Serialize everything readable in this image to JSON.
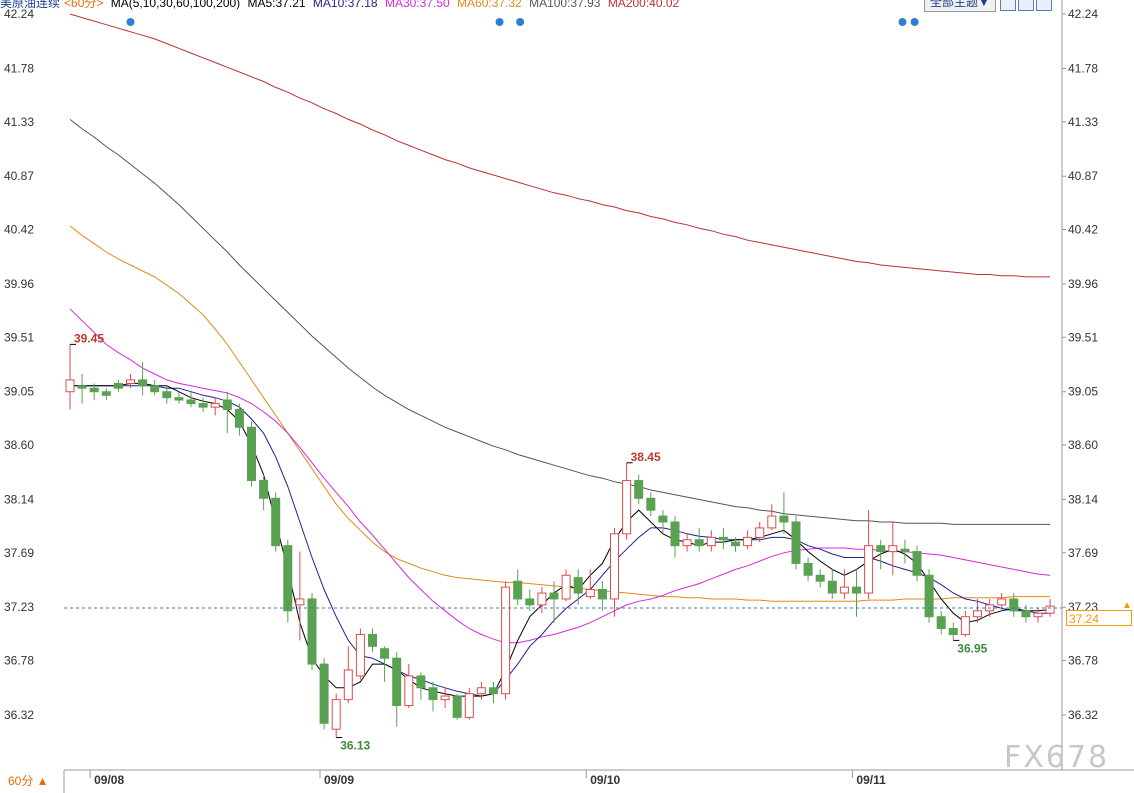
{
  "legend": {
    "symbol": "美原油连续",
    "period_tag": "<60分>",
    "ma_label": "MA(5,10,30,60,100,200)",
    "ma5": "MA5:37.21",
    "ma10": "MA10:37.18",
    "ma30": "MA30:37.50",
    "ma60": "MA60:37.32",
    "ma100": "MA100:37.93",
    "ma200": "MA200:40.02"
  },
  "toolbar": {
    "theme_label": "全部主题▼",
    "zoom_in_icon": "zoom-in-icon",
    "zoom_out_icon": "zoom-out-icon",
    "settings_icon": "settings-icon"
  },
  "period_button": "60分 ▲",
  "watermark": "FX678",
  "current_price": "37.24",
  "colors": {
    "up": "#e04b4b",
    "down": "#5aa152",
    "ma5": "#000000",
    "ma10": "#1f1f8f",
    "ma30": "#d52cd6",
    "ma60": "#e08a18",
    "ma100": "#555555",
    "ma200": "#b83232",
    "dots": "#2f7fd1",
    "last_price": "#2e7fb8"
  },
  "chart_data": {
    "type": "candlestick",
    "y_ticks": [
      "42.24",
      "41.78",
      "41.33",
      "40.87",
      "40.42",
      "39.96",
      "39.51",
      "39.05",
      "38.60",
      "38.14",
      "37.69",
      "37.23",
      "36.78",
      "36.32"
    ],
    "ylim": [
      35.99,
      42.38
    ],
    "x_ticks": [
      {
        "index": 1,
        "label": "09/08"
      },
      {
        "index": 20,
        "label": "09/09"
      },
      {
        "index": 42,
        "label": "09/10"
      },
      {
        "index": 64,
        "label": "09/11"
      }
    ],
    "grid": false,
    "legend": "top-left",
    "candles": [
      [
        39.05,
        39.15,
        39.45,
        38.9
      ],
      [
        39.1,
        39.08,
        39.2,
        38.95
      ],
      [
        39.08,
        39.05,
        39.12,
        38.98
      ],
      [
        39.05,
        39.02,
        39.08,
        38.98
      ],
      [
        39.12,
        39.08,
        39.15,
        39.05
      ],
      [
        39.12,
        39.15,
        39.2,
        39.08
      ],
      [
        39.15,
        39.1,
        39.3,
        39.02
      ],
      [
        39.1,
        39.05,
        39.15,
        39.02
      ],
      [
        39.05,
        39.0,
        39.1,
        38.95
      ],
      [
        39.0,
        38.98,
        39.05,
        38.95
      ],
      [
        38.98,
        38.95,
        39.05,
        38.92
      ],
      [
        38.95,
        38.92,
        39.0,
        38.88
      ],
      [
        38.92,
        38.95,
        39.0,
        38.85
      ],
      [
        38.98,
        38.9,
        39.05,
        38.7
      ],
      [
        38.9,
        38.75,
        38.95,
        38.68
      ],
      [
        38.75,
        38.3,
        38.8,
        38.25
      ],
      [
        38.3,
        38.15,
        38.35,
        38.05
      ],
      [
        38.15,
        37.75,
        38.2,
        37.7
      ],
      [
        37.75,
        37.2,
        37.8,
        37.1
      ],
      [
        37.25,
        37.3,
        37.7,
        36.95
      ],
      [
        37.3,
        36.75,
        37.35,
        36.7
      ],
      [
        36.75,
        36.25,
        36.8,
        36.2
      ],
      [
        36.2,
        36.45,
        36.5,
        36.13
      ],
      [
        36.45,
        36.7,
        36.9,
        36.42
      ],
      [
        36.65,
        37.0,
        37.05,
        36.62
      ],
      [
        37.0,
        36.9,
        37.05,
        36.85
      ],
      [
        36.88,
        36.8,
        36.9,
        36.6
      ],
      [
        36.8,
        36.4,
        36.85,
        36.22
      ],
      [
        36.4,
        36.65,
        36.75,
        36.38
      ],
      [
        36.65,
        36.55,
        36.68,
        36.45
      ],
      [
        36.55,
        36.45,
        36.6,
        36.35
      ],
      [
        36.45,
        36.48,
        36.55,
        36.38
      ],
      [
        36.48,
        36.3,
        36.5,
        36.28
      ],
      [
        36.3,
        36.5,
        36.55,
        36.28
      ],
      [
        36.5,
        36.55,
        36.6,
        36.45
      ],
      [
        36.55,
        36.5,
        36.6,
        36.42
      ],
      [
        36.5,
        37.4,
        37.45,
        36.45
      ],
      [
        37.45,
        37.3,
        37.55,
        37.25
      ],
      [
        37.3,
        37.25,
        37.38,
        37.2
      ],
      [
        37.25,
        37.35,
        37.4,
        37.18
      ],
      [
        37.35,
        37.3,
        37.45,
        37.1
      ],
      [
        37.3,
        37.5,
        37.55,
        37.28
      ],
      [
        37.48,
        37.35,
        37.55,
        37.25
      ],
      [
        37.32,
        37.38,
        37.55,
        37.3
      ],
      [
        37.38,
        37.3,
        37.45,
        37.2
      ],
      [
        37.3,
        37.85,
        37.9,
        37.15
      ],
      [
        37.85,
        38.3,
        38.45,
        37.8
      ],
      [
        38.3,
        38.15,
        38.35,
        38.1
      ],
      [
        38.15,
        38.05,
        38.2,
        38.0
      ],
      [
        38.0,
        37.95,
        38.05,
        37.85
      ],
      [
        37.95,
        37.75,
        38.0,
        37.65
      ],
      [
        37.75,
        37.8,
        37.85,
        37.7
      ],
      [
        37.8,
        37.75,
        37.9,
        37.7
      ],
      [
        37.75,
        37.82,
        37.88,
        37.7
      ],
      [
        37.82,
        37.8,
        37.9,
        37.72
      ],
      [
        37.78,
        37.75,
        37.82,
        37.7
      ],
      [
        37.75,
        37.82,
        37.88,
        37.72
      ],
      [
        37.82,
        37.9,
        37.95,
        37.78
      ],
      [
        37.9,
        38.0,
        38.1,
        37.88
      ],
      [
        38.0,
        37.95,
        38.2,
        37.85
      ],
      [
        37.95,
        37.6,
        38.0,
        37.55
      ],
      [
        37.6,
        37.5,
        37.65,
        37.45
      ],
      [
        37.5,
        37.45,
        37.55,
        37.4
      ],
      [
        37.45,
        37.35,
        37.55,
        37.3
      ],
      [
        37.35,
        37.4,
        37.55,
        37.3
      ],
      [
        37.4,
        37.35,
        37.55,
        37.15
      ],
      [
        37.35,
        37.75,
        38.05,
        37.3
      ],
      [
        37.75,
        37.7,
        37.8,
        37.55
      ],
      [
        37.7,
        37.75,
        37.95,
        37.5
      ],
      [
        37.72,
        37.7,
        37.8,
        37.6
      ],
      [
        37.7,
        37.5,
        37.75,
        37.45
      ],
      [
        37.5,
        37.15,
        37.55,
        37.1
      ],
      [
        37.15,
        37.05,
        37.2,
        37.0
      ],
      [
        37.05,
        37.0,
        37.1,
        36.95
      ],
      [
        37.0,
        37.15,
        37.2,
        36.98
      ],
      [
        37.15,
        37.2,
        37.3,
        37.1
      ],
      [
        37.2,
        37.25,
        37.3,
        37.15
      ],
      [
        37.25,
        37.3,
        37.35,
        37.2
      ],
      [
        37.3,
        37.2,
        37.35,
        37.15
      ],
      [
        37.2,
        37.15,
        37.25,
        37.1
      ],
      [
        37.15,
        37.18,
        37.22,
        37.1
      ],
      [
        37.18,
        37.24,
        37.3,
        37.15
      ]
    ],
    "ma5": [
      39.1,
      39.1,
      39.1,
      39.1,
      39.1,
      39.12,
      39.12,
      39.1,
      39.1,
      39.05,
      39.0,
      38.97,
      38.95,
      38.9,
      38.8,
      38.6,
      38.35,
      37.95,
      37.55,
      37.1,
      36.8,
      36.65,
      36.55,
      36.55,
      36.6,
      36.75,
      36.75,
      36.7,
      36.62,
      36.55,
      36.52,
      36.5,
      36.48,
      36.48,
      36.48,
      36.5,
      36.7,
      36.95,
      37.15,
      37.25,
      37.35,
      37.42,
      37.38,
      37.5,
      37.6,
      37.8,
      37.95,
      38.05,
      37.95,
      37.85,
      37.8,
      37.78,
      37.75,
      37.78,
      37.78,
      37.8,
      37.8,
      37.82,
      37.85,
      37.88,
      37.8,
      37.7,
      37.62,
      37.55,
      37.5,
      37.55,
      37.62,
      37.68,
      37.72,
      37.68,
      37.6,
      37.45,
      37.3,
      37.18,
      37.1,
      37.12,
      37.17,
      37.2,
      37.22,
      37.2,
      37.2,
      37.21
    ],
    "ma10": [
      39.1,
      39.1,
      39.1,
      39.1,
      39.1,
      39.1,
      39.1,
      39.1,
      39.08,
      39.08,
      39.05,
      39.02,
      39.0,
      38.97,
      38.92,
      38.82,
      38.7,
      38.5,
      38.25,
      37.95,
      37.65,
      37.38,
      37.15,
      36.95,
      36.82,
      36.8,
      36.75,
      36.7,
      36.65,
      36.62,
      36.58,
      36.55,
      36.52,
      36.5,
      36.48,
      36.5,
      36.62,
      36.75,
      36.9,
      37.0,
      37.12,
      37.22,
      37.3,
      37.38,
      37.5,
      37.62,
      37.72,
      37.82,
      37.9,
      37.9,
      37.88,
      37.85,
      37.83,
      37.82,
      37.8,
      37.8,
      37.8,
      37.8,
      37.82,
      37.82,
      37.8,
      37.75,
      37.72,
      37.68,
      37.65,
      37.65,
      37.65,
      37.62,
      37.58,
      37.55,
      37.52,
      37.48,
      37.42,
      37.35,
      37.3,
      37.28,
      37.25,
      37.22,
      37.2,
      37.2,
      37.18,
      37.18
    ],
    "ma30": [
      39.75,
      39.65,
      39.55,
      39.45,
      39.38,
      39.32,
      39.25,
      39.2,
      39.15,
      39.12,
      39.1,
      39.08,
      39.06,
      39.04,
      39.0,
      38.95,
      38.88,
      38.8,
      38.7,
      38.58,
      38.45,
      38.32,
      38.2,
      38.08,
      37.95,
      37.84,
      37.72,
      37.6,
      37.48,
      37.38,
      37.28,
      37.2,
      37.12,
      37.05,
      37.0,
      36.96,
      36.93,
      36.93,
      36.95,
      36.98,
      37.0,
      37.03,
      37.06,
      37.1,
      37.15,
      37.2,
      37.25,
      37.28,
      37.3,
      37.33,
      37.37,
      37.4,
      37.43,
      37.47,
      37.51,
      37.55,
      37.58,
      37.62,
      37.66,
      37.69,
      37.71,
      37.72,
      37.73,
      37.73,
      37.73,
      37.72,
      37.72,
      37.71,
      37.7,
      37.7,
      37.69,
      37.68,
      37.67,
      37.65,
      37.63,
      37.61,
      37.59,
      37.57,
      37.55,
      37.53,
      37.51,
      37.5
    ],
    "ma60": [
      40.45,
      40.37,
      40.3,
      40.23,
      40.17,
      40.12,
      40.07,
      40.02,
      39.95,
      39.88,
      39.79,
      39.7,
      39.58,
      39.45,
      39.3,
      39.15,
      39.0,
      38.85,
      38.7,
      38.55,
      38.4,
      38.25,
      38.1,
      37.98,
      37.88,
      37.78,
      37.7,
      37.64,
      37.6,
      37.56,
      37.53,
      37.5,
      37.48,
      37.47,
      37.46,
      37.45,
      37.44,
      37.44,
      37.43,
      37.42,
      37.41,
      37.4,
      37.39,
      37.38,
      37.37,
      37.36,
      37.35,
      37.34,
      37.33,
      37.32,
      37.32,
      37.31,
      37.31,
      37.3,
      37.3,
      37.3,
      37.29,
      37.29,
      37.28,
      37.28,
      37.28,
      37.28,
      37.28,
      37.28,
      37.28,
      37.28,
      37.29,
      37.29,
      37.29,
      37.3,
      37.3,
      37.3,
      37.3,
      37.31,
      37.31,
      37.31,
      37.31,
      37.31,
      37.32,
      37.32,
      37.32,
      37.32
    ],
    "ma100": [
      41.35,
      41.27,
      41.2,
      41.12,
      41.05,
      40.97,
      40.89,
      40.81,
      40.72,
      40.63,
      40.53,
      40.43,
      40.33,
      40.23,
      40.12,
      40.02,
      39.92,
      39.82,
      39.72,
      39.62,
      39.52,
      39.43,
      39.34,
      39.25,
      39.17,
      39.09,
      39.02,
      38.96,
      38.9,
      38.85,
      38.8,
      38.75,
      38.71,
      38.67,
      38.63,
      38.59,
      38.56,
      38.52,
      38.49,
      38.46,
      38.43,
      38.4,
      38.37,
      38.34,
      38.32,
      38.29,
      38.27,
      38.25,
      38.22,
      38.2,
      38.18,
      38.16,
      38.14,
      38.12,
      38.1,
      38.08,
      38.07,
      38.05,
      38.04,
      38.02,
      38.01,
      38.0,
      37.99,
      37.98,
      37.97,
      37.96,
      37.96,
      37.95,
      37.95,
      37.94,
      37.94,
      37.94,
      37.94,
      37.93,
      37.93,
      37.93,
      37.93,
      37.93,
      37.93,
      37.93,
      37.93,
      37.93
    ],
    "ma200": [
      42.24,
      42.21,
      42.18,
      42.15,
      42.12,
      42.09,
      42.06,
      42.03,
      41.99,
      41.95,
      41.91,
      41.87,
      41.83,
      41.79,
      41.75,
      41.71,
      41.67,
      41.62,
      41.58,
      41.53,
      41.49,
      41.44,
      41.4,
      41.35,
      41.31,
      41.26,
      41.22,
      41.17,
      41.13,
      41.09,
      41.05,
      41.01,
      40.98,
      40.94,
      40.91,
      40.88,
      40.85,
      40.82,
      40.79,
      40.76,
      40.73,
      40.71,
      40.68,
      40.66,
      40.63,
      40.61,
      40.58,
      40.56,
      40.53,
      40.51,
      40.48,
      40.46,
      40.43,
      40.41,
      40.38,
      40.36,
      40.33,
      40.31,
      40.29,
      40.27,
      40.25,
      40.23,
      40.21,
      40.19,
      40.17,
      40.15,
      40.14,
      40.12,
      40.11,
      40.1,
      40.09,
      40.08,
      40.07,
      40.06,
      40.05,
      40.04,
      40.04,
      40.03,
      40.03,
      40.02,
      40.02,
      40.02
    ],
    "annotations": [
      {
        "index": 0,
        "value": 39.45,
        "label": "39.45",
        "kind": "high"
      },
      {
        "index": 22,
        "value": 36.13,
        "label": "36.13",
        "kind": "low"
      },
      {
        "index": 46,
        "value": 38.45,
        "label": "38.45",
        "kind": "high"
      },
      {
        "index": 73,
        "value": 36.95,
        "label": "36.95",
        "kind": "low"
      }
    ],
    "event_dots": [
      5,
      35.5,
      37.2,
      68.8,
      69.8,
      105.5
    ],
    "last_price": 37.24
  }
}
